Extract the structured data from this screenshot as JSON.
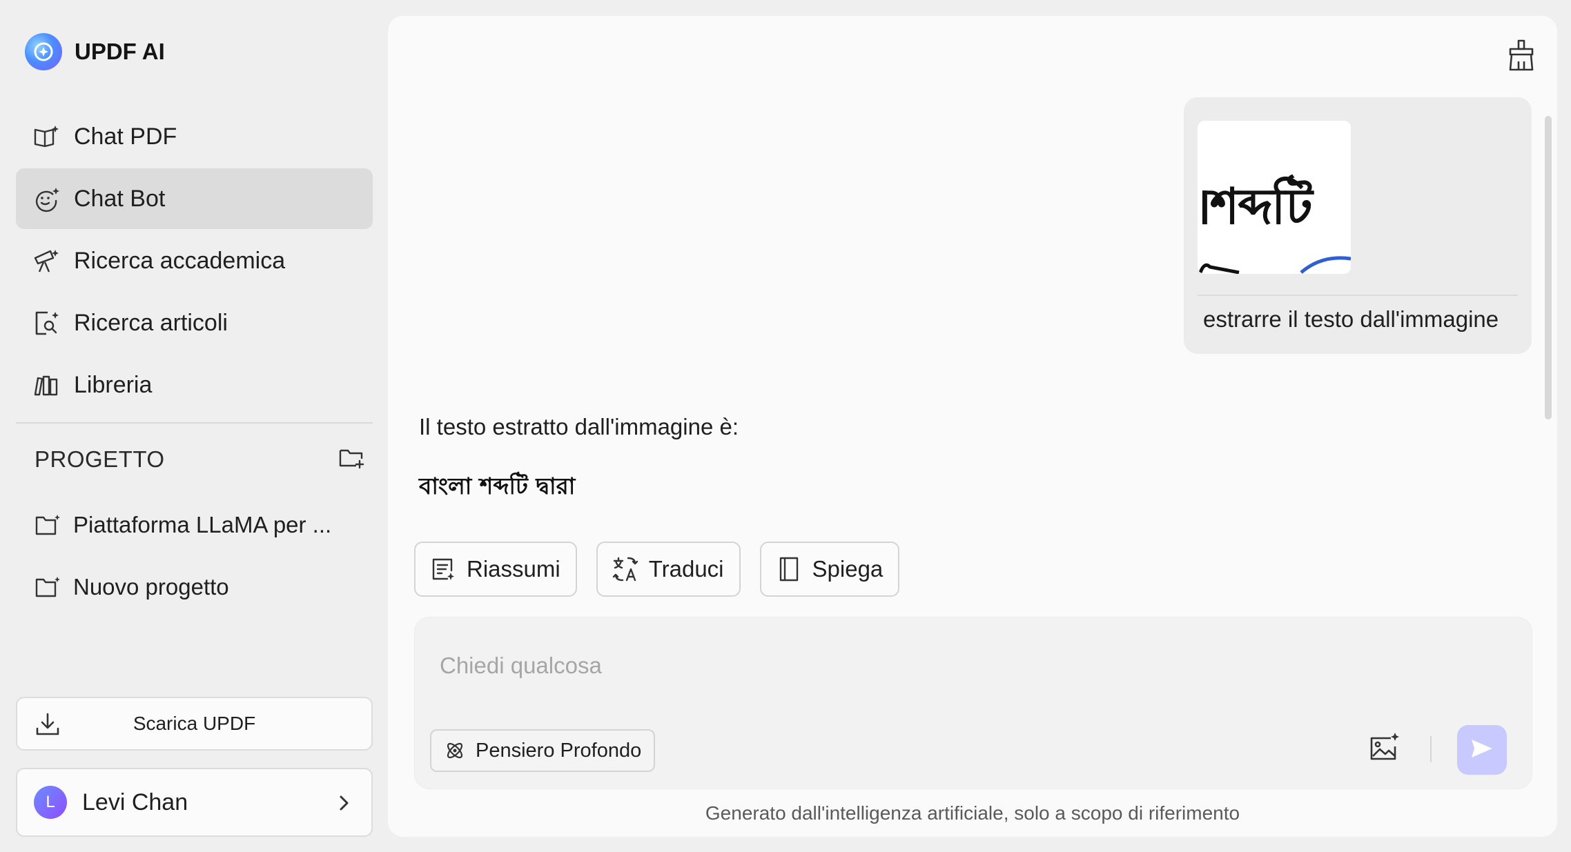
{
  "app": {
    "title": "UPDF AI"
  },
  "sidebar": {
    "items": [
      {
        "label": "Chat PDF",
        "icon": "book-sparkle-icon",
        "active": false
      },
      {
        "label": "Chat Bot",
        "icon": "bot-face-icon",
        "active": true
      },
      {
        "label": "Ricerca accademica",
        "icon": "telescope-icon",
        "active": false
      },
      {
        "label": "Ricerca articoli",
        "icon": "document-search-icon",
        "active": false
      },
      {
        "label": "Libreria",
        "icon": "library-icon",
        "active": false
      }
    ],
    "project": {
      "title": "PROGETTO",
      "items": [
        {
          "label": "Piattaforma LLaMA per ...",
          "icon": "folder-icon"
        },
        {
          "label": "Nuovo progetto",
          "icon": "folder-icon"
        }
      ]
    },
    "download_label": "Scarica UPDF",
    "user": {
      "initial": "L",
      "name": "Levi Chan"
    }
  },
  "chat": {
    "user_message": {
      "image_text": "।শব্দটি",
      "text": "estrarre il testo dall'immagine"
    },
    "answer": {
      "intro": "Il testo estratto dall'immagine è:",
      "bengali": "বাংলা শব্দটি দ্বারা"
    },
    "actions": [
      {
        "label": "Riassumi",
        "icon": "summary-icon"
      },
      {
        "label": "Traduci",
        "icon": "translate-icon"
      },
      {
        "label": "Spiega",
        "icon": "book-icon"
      }
    ],
    "input": {
      "placeholder": "Chiedi qualcosa",
      "deep_label": "Pensiero Profondo"
    },
    "disclaimer": "Generato dall'intelligenza artificiale, solo a scopo di riferimento"
  },
  "colors": {
    "accent": "#7b5cff",
    "send_button": "#c7c9ff",
    "active_nav": "#dcdcdc"
  }
}
